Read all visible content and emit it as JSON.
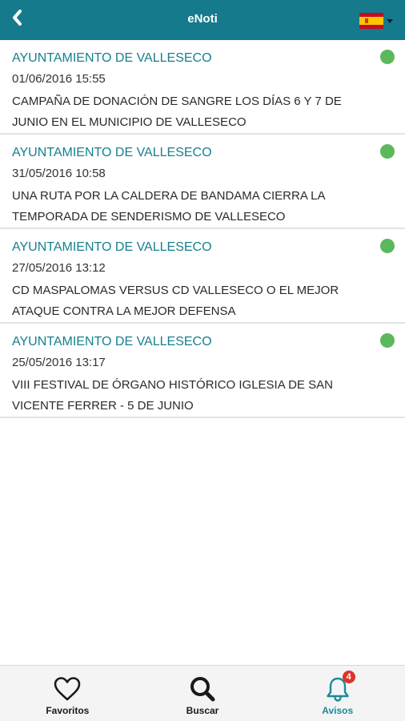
{
  "header": {
    "title": "eNoti",
    "back_icon": "chevron-left-icon",
    "language_flag": "spain-flag",
    "background": "#157a8c"
  },
  "notices": [
    {
      "sender": "AYUNTAMIENTO DE VALLESECO",
      "date": "01/06/2016 15:55",
      "headline": "CAMPAÑA DE DONACIÓN DE SANGRE LOS DÍAS 6 Y 7 DE JUNIO EN EL MUNICIPIO DE VALLESECO"
    },
    {
      "sender": "AYUNTAMIENTO DE VALLESECO",
      "date": "31/05/2016 10:58",
      "headline": "UNA RUTA POR LA CALDERA DE BANDAMA CIERRA LA TEMPORADA DE SENDERISMO DE VALLESECO"
    },
    {
      "sender": "AYUNTAMIENTO DE VALLESECO",
      "date": "27/05/2016 13:12",
      "headline": "CD MASPALOMAS VERSUS CD VALLESECO O EL MEJOR ATAQUE CONTRA LA MEJOR DEFENSA"
    },
    {
      "sender": "AYUNTAMIENTO DE VALLESECO",
      "date": "25/05/2016 13:17",
      "headline": "VIII FESTIVAL DE ÓRGANO HISTÓRICO IGLESIA DE SAN VICENTE FERRER - 5 DE JUNIO"
    }
  ],
  "unread_dot_color": "#5cb85c",
  "tabbar": {
    "tabs": [
      {
        "label": "Favoritos",
        "icon": "heart-icon",
        "active": false
      },
      {
        "label": "Buscar",
        "icon": "search-icon",
        "active": false
      },
      {
        "label": "Avisos",
        "icon": "bell-icon",
        "active": true,
        "badge": "4"
      }
    ],
    "active_color": "#1b8a9a",
    "badge_color": "#d9352c"
  }
}
